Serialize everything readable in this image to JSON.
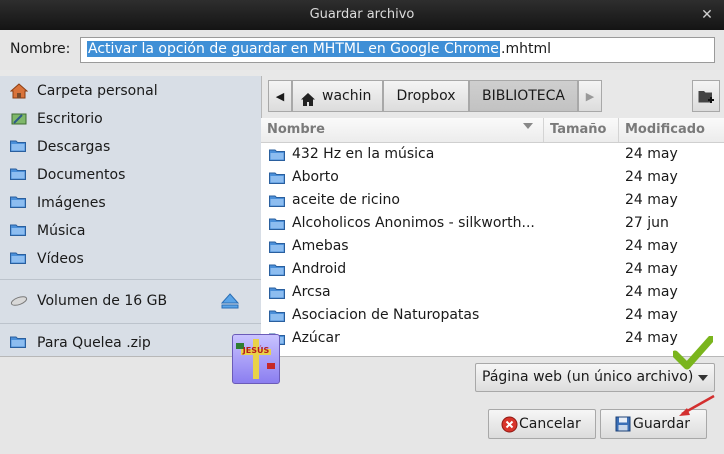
{
  "window": {
    "title": "Guardar archivo"
  },
  "name_row": {
    "label": "Nombre:",
    "selected_text": "Activar la opción de guardar en MHTML en Google Chrome",
    "rest_text": ".mhtml"
  },
  "sidebar": {
    "items": [
      {
        "label": "Carpeta personal",
        "icon": "home-icon"
      },
      {
        "label": "Escritorio",
        "icon": "desktop-icon"
      },
      {
        "label": "Descargas",
        "icon": "folder-icon"
      },
      {
        "label": "Documentos",
        "icon": "folder-icon"
      },
      {
        "label": "Imágenes",
        "icon": "folder-icon"
      },
      {
        "label": "Música",
        "icon": "folder-icon"
      },
      {
        "label": "Vídeos",
        "icon": "folder-icon"
      }
    ],
    "volume": {
      "label": "Volumen de 16 GB",
      "icon": "drive-icon",
      "action_icon": "eject-icon"
    },
    "bookmark": {
      "label": "Para Quelea .zip",
      "icon": "folder-icon"
    }
  },
  "path": {
    "crumbs": [
      "wachin",
      "Dropbox",
      "BIBLIOTECA"
    ],
    "active": "BIBLIOTECA"
  },
  "columns": {
    "name": "Nombre",
    "size": "Tamaño",
    "modified": "Modificado"
  },
  "files": [
    {
      "name": "432 Hz en la música",
      "date": "24 may"
    },
    {
      "name": "Aborto",
      "date": "24 may"
    },
    {
      "name": "aceite de ricino",
      "date": "24 may"
    },
    {
      "name": "Alcoholicos Anonimos - silkworth...",
      "date": "27 jun"
    },
    {
      "name": "Amebas",
      "date": "24 may"
    },
    {
      "name": "Android",
      "date": "24 may"
    },
    {
      "name": "Arcsa",
      "date": "24 may"
    },
    {
      "name": "Asociacion de Naturopatas",
      "date": "24 may"
    },
    {
      "name": "Azúcar",
      "date": "24 may"
    }
  ],
  "file_type": {
    "selected": "Página web (un único archivo)"
  },
  "buttons": {
    "cancel": "Cancelar",
    "save": "Guardar"
  },
  "colors": {
    "selection": "#3f8fd6",
    "folder": "#4a8fd9",
    "check": "#7ab51d"
  }
}
